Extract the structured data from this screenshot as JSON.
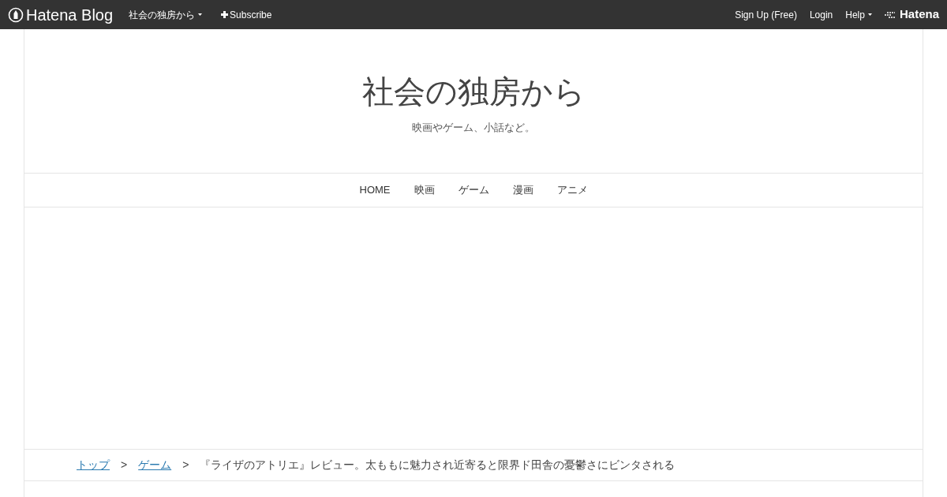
{
  "topbar": {
    "logo": "Hatena Blog",
    "blog_menu": "社会の独房から",
    "subscribe": "Subscribe",
    "links": [
      {
        "label": "Sign Up (Free)",
        "dropdown": false
      },
      {
        "label": "Login",
        "dropdown": false
      },
      {
        "label": "Help",
        "dropdown": true
      }
    ],
    "brand": "Hatena"
  },
  "header": {
    "title": "社会の独房から",
    "description": "映画やゲーム、小話など。"
  },
  "nav": [
    "HOME",
    "映画",
    "ゲーム",
    "漫画",
    "アニメ"
  ],
  "breadcrumb": [
    {
      "label": "トップ",
      "link": true
    },
    {
      "label": ">",
      "link": false
    },
    {
      "label": "ゲーム",
      "link": true
    },
    {
      "label": ">",
      "link": false
    },
    {
      "label": "『ライザのアトリエ』レビュー。太ももに魅力され近寄ると限界ド田舎の憂鬱さにビンタされる",
      "link": false
    }
  ]
}
